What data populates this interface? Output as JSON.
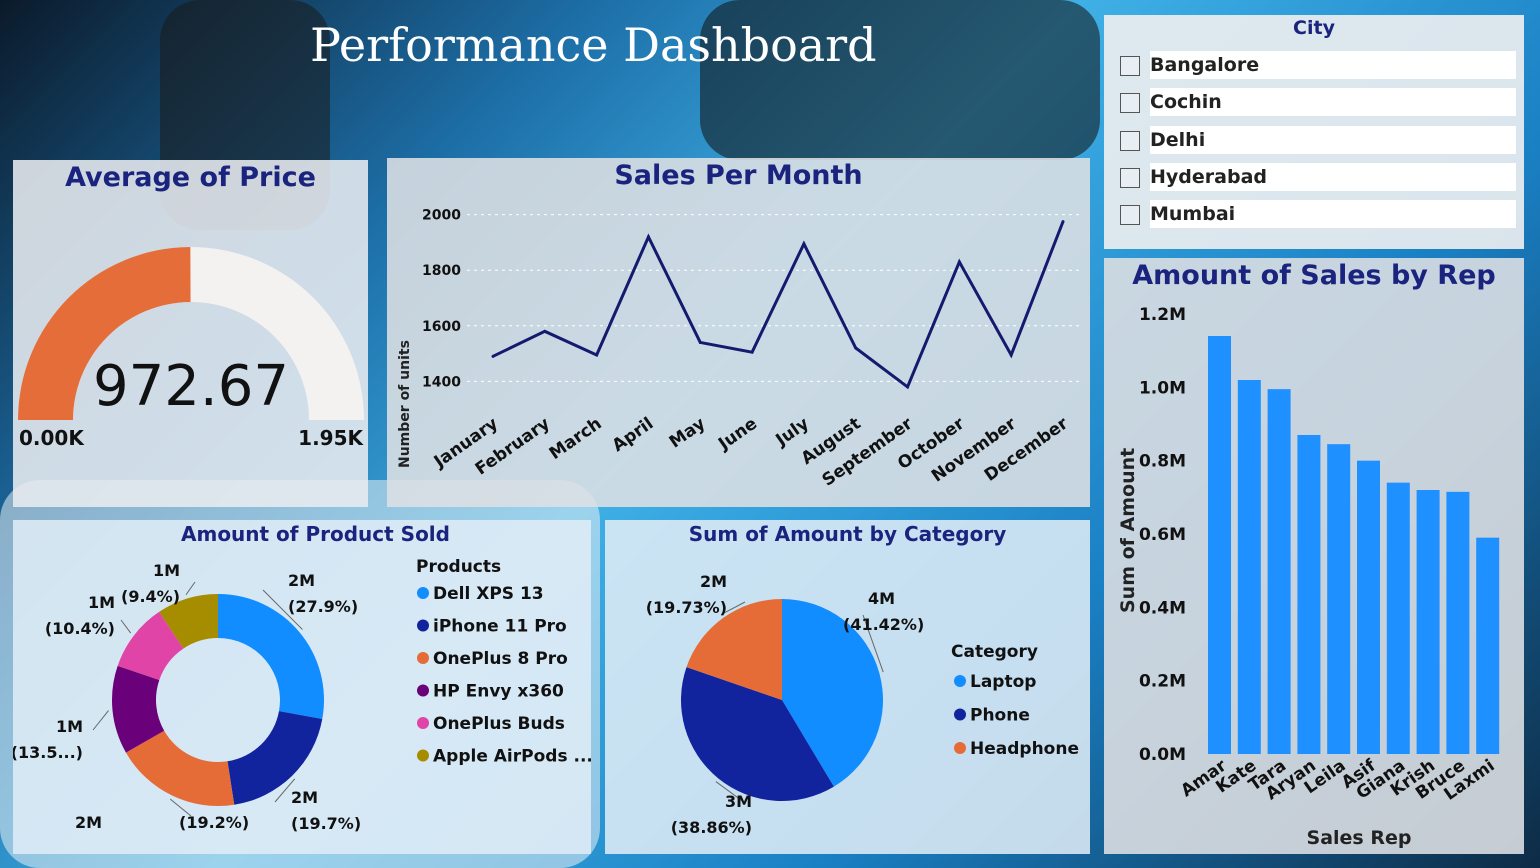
{
  "dashboard": {
    "title": "Performance Dashboard"
  },
  "city_slicer": {
    "title": "City",
    "items": [
      "Bangalore",
      "Cochin",
      "Delhi",
      "Hyderabad",
      "Mumbai"
    ]
  },
  "colors": {
    "gauge_fill": "#e46d3a",
    "gauge_track": "#f3f2f1",
    "line": "#141b6e",
    "bar": "#1e90ff",
    "title_text": "#1a237e"
  },
  "chart_data": [
    {
      "id": "gauge",
      "type": "gauge",
      "title": "Average of Price",
      "value": 972.67,
      "value_label": "972.67",
      "min": 0,
      "max": 1950,
      "min_label": "0.00K",
      "max_label": "1.95K"
    },
    {
      "id": "line",
      "type": "line",
      "title": "Sales Per Month",
      "ylabel": "Number of units",
      "xlabel": "",
      "categories": [
        "January",
        "February",
        "March",
        "April",
        "May",
        "June",
        "July",
        "August",
        "September",
        "October",
        "November",
        "December"
      ],
      "values": [
        1490,
        1580,
        1495,
        1920,
        1540,
        1505,
        1895,
        1520,
        1380,
        1830,
        1495,
        1975
      ],
      "yticks": [
        "1400",
        "1600",
        "1800",
        "2000"
      ],
      "ytick_values": [
        1400,
        1600,
        1800,
        2000
      ],
      "ylim": [
        1340,
        2060
      ],
      "grid": true
    },
    {
      "id": "bar",
      "type": "bar",
      "title": "Amount of Sales by Rep",
      "xlabel": "Sales Rep",
      "ylabel": "Sum of Amount",
      "categories": [
        "Amar",
        "Kate",
        "Tara",
        "Aryan",
        "Leila",
        "Asif",
        "Giana",
        "Krish",
        "Bruce",
        "Laxmi"
      ],
      "values": [
        1140000,
        1020000,
        995000,
        870000,
        845000,
        800000,
        740000,
        720000,
        715000,
        590000
      ],
      "yticks": [
        "0.0M",
        "0.2M",
        "0.4M",
        "0.6M",
        "0.8M",
        "1.0M",
        "1.2M"
      ],
      "ytick_values": [
        0,
        200000,
        400000,
        600000,
        800000,
        1000000,
        1200000
      ],
      "ylim": [
        0,
        1200000
      ]
    },
    {
      "id": "donut",
      "type": "pie",
      "title": "Amount of Product Sold",
      "legend_title": "Products",
      "slices": [
        {
          "name": "Dell XPS 13",
          "percent": 27.9,
          "label": "2M",
          "pct_label": "(27.9%)",
          "color": "#118dff"
        },
        {
          "name": "iPhone 11 Pro",
          "percent": 19.7,
          "label": "2M",
          "pct_label": "(19.7%)",
          "color": "#12239e"
        },
        {
          "name": "OnePlus 8 Pro",
          "percent": 19.2,
          "label": "2M",
          "pct_label": "(19.2%)",
          "color": "#e66c37"
        },
        {
          "name": "HP Envy x360",
          "percent": 13.5,
          "label": "1M",
          "pct_label": "(13.5...)",
          "color": "#6b007b"
        },
        {
          "name": "OnePlus Buds",
          "percent": 10.4,
          "label": "1M",
          "pct_label": "(10.4%)",
          "color": "#e044a7"
        },
        {
          "name": "Apple AirPods ...",
          "percent": 9.4,
          "label": "1M",
          "pct_label": "(9.4%)",
          "color": "#a68d00"
        }
      ]
    },
    {
      "id": "pie",
      "type": "pie",
      "title": "Sum of Amount by Category",
      "legend_title": "Category",
      "slices": [
        {
          "name": "Laptop",
          "percent": 41.42,
          "label": "4M",
          "pct_label": "(41.42%)",
          "color": "#118dff"
        },
        {
          "name": "Phone",
          "percent": 38.86,
          "label": "3M",
          "pct_label": "(38.86%)",
          "color": "#12239e"
        },
        {
          "name": "Headphone",
          "percent": 19.73,
          "label": "2M",
          "pct_label": "(19.73%)",
          "color": "#e66c37"
        }
      ]
    }
  ]
}
